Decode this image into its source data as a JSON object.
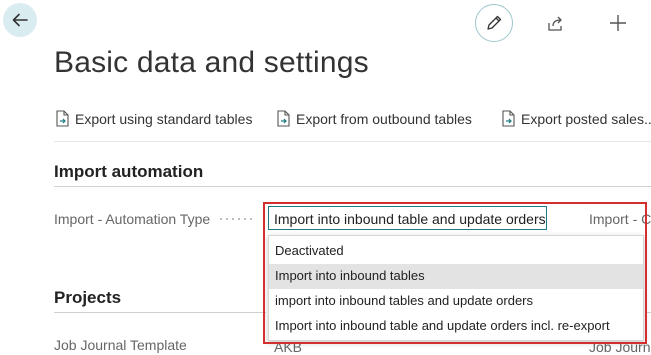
{
  "page": {
    "title": "Basic data and settings"
  },
  "actions": [
    {
      "label": "Export using standard tables"
    },
    {
      "label": "Export from outbound tables"
    },
    {
      "label": "Export posted sales...o"
    }
  ],
  "sections": {
    "import_automation": {
      "title": "Import automation",
      "automation_type": {
        "label": "Import - Automation Type",
        "value": "Import into inbound table and update orders",
        "options": [
          "Deactivated",
          "Import into inbound tables",
          "import into inbound tables and update orders",
          "Import into inbound table and update orders incl. re-export"
        ],
        "highlighted_option": "Import into inbound tables"
      },
      "next_label": "Import - C"
    },
    "projects": {
      "title": "Projects",
      "job_journal_template": {
        "label": "Job Journal Template",
        "value": "AKB"
      },
      "right_partial_label": "Job Journ"
    }
  },
  "colors": {
    "accent": "#1b7b83",
    "highlight_border": "#d32f2f",
    "back_button_bg": "#d9ecef"
  }
}
